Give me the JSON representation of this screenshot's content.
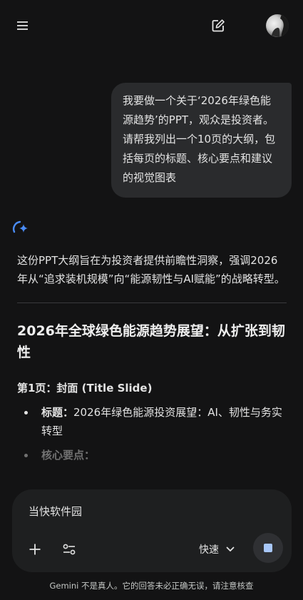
{
  "header": {
    "menu_icon": "menu-icon",
    "new_chat_icon": "edit-icon",
    "avatar_icon": "avatar"
  },
  "user_message": {
    "text": "我要做一个关于‘2026年绿色能源趋势’的PPT，观众是投资者。请帮我列出一个10页的大纲，包括每页的标题、核心要点和建议的视觉图表"
  },
  "response": {
    "intro": "这份PPT大纲旨在为投资者提供前瞻性洞察，强调2026年从“追求装机规模”向“能源韧性与AI赋能”的战略转型。",
    "title": "2026年全球绿色能源趋势展望：从扩张到韧性",
    "sections": [
      {
        "heading": "第1页：封面 (Title Slide)",
        "bullets": [
          {
            "term": "标题：",
            "text": "2026年绿色能源投资展望：AI、韧性与务实转型"
          },
          {
            "term": "核心要点：",
            "text": ""
          }
        ]
      }
    ]
  },
  "composer": {
    "input_value": "当快软件园",
    "mode_label": "快速",
    "plus_icon": "plus-icon",
    "tools_icon": "tune-icon",
    "chevron_icon": "chevron-down-icon",
    "stop_icon": "stop-icon"
  },
  "footer": {
    "disclaimer": "Gemini 不是真人。它的回答未必正确无误，请注意核查"
  },
  "colors": {
    "background": "#131314",
    "bubble": "#2a2b2d",
    "composer": "#1e1f20",
    "accent": "#a8c7fa",
    "spark_blue": "#4a8cf7"
  }
}
